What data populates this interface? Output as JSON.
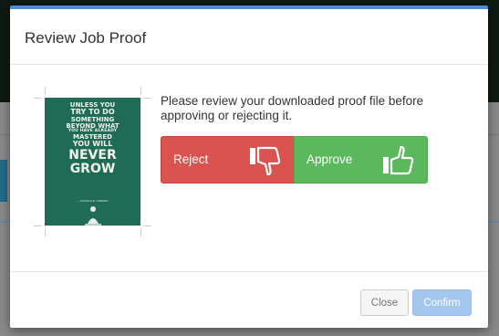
{
  "dialog": {
    "title": "Review Job Proof",
    "message": "Please review your downloaded proof file before approving or rejecting it.",
    "reject_label": "Reject",
    "approve_label": "Approve",
    "close_label": "Close",
    "confirm_label": "Confirm"
  },
  "proof": {
    "lines": [
      "UNLESS YOU",
      "TRY TO DO",
      "SOMETHING",
      "BEYOND WHAT",
      "YOU HAVE ALREADY",
      "MASTERED",
      "YOU WILL",
      "NEVER",
      "GROW"
    ],
    "author": "— RONALD E. OSBORN"
  },
  "colors": {
    "accent": "#4d8be0",
    "reject": "#d9534f",
    "approve": "#5cb85c",
    "confirm_disabled": "#a3c6ee",
    "poster_bg": "#1f6b56"
  },
  "icons": {
    "reject": "thumbs-down-icon",
    "approve": "thumbs-up-icon"
  }
}
